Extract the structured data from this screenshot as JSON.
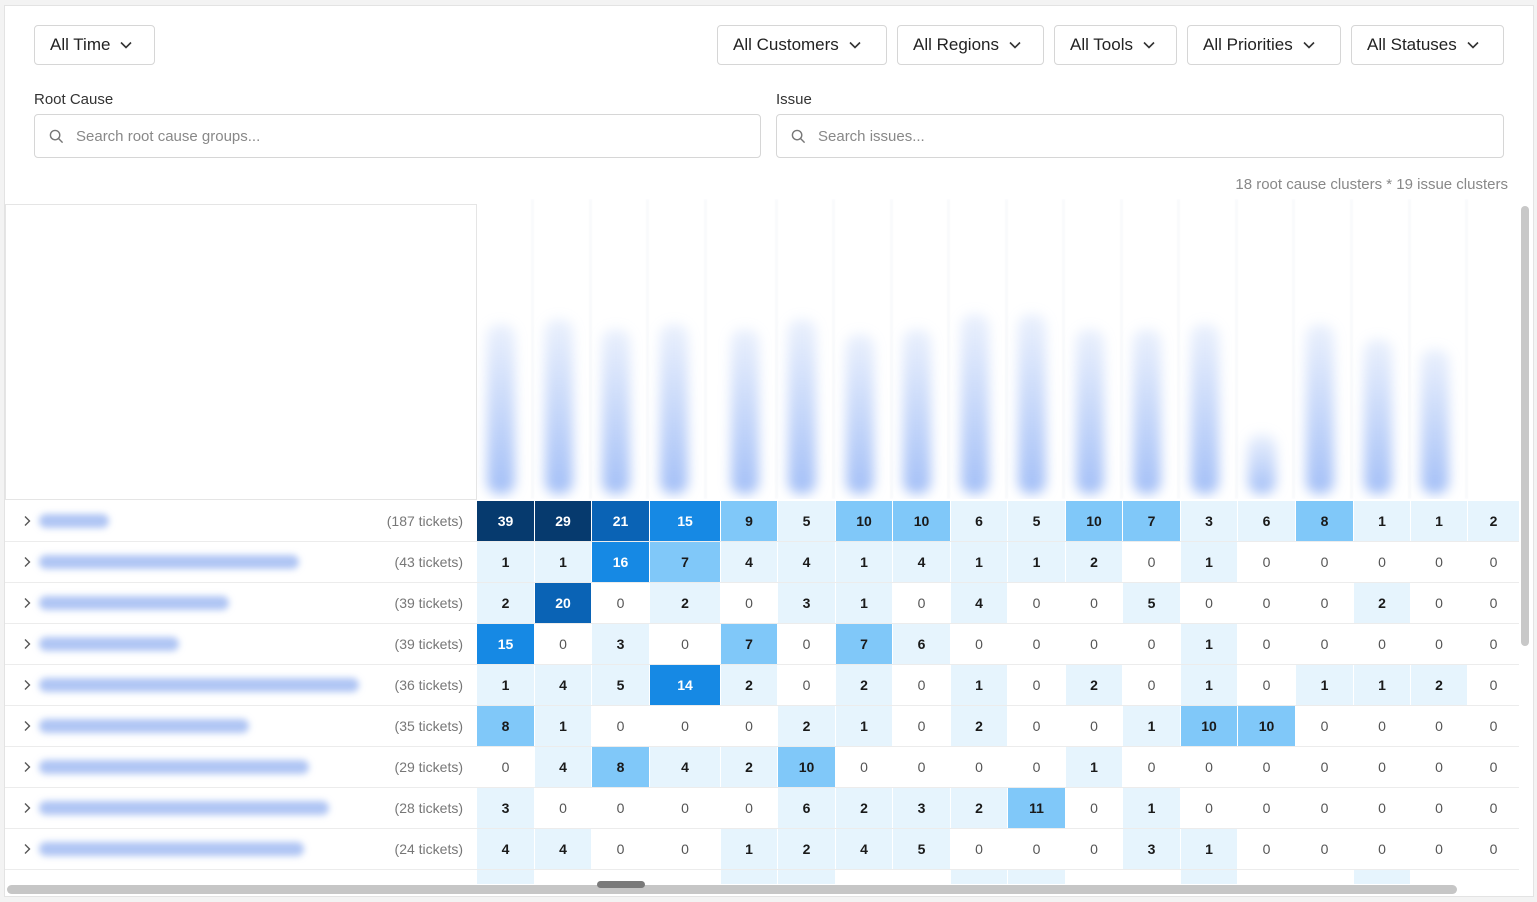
{
  "filters": {
    "time": "All Time",
    "customers": "All Customers",
    "regions": "All Regions",
    "tools": "All Tools",
    "priorities": "All Priorities",
    "statuses": "All Statuses"
  },
  "root_cause": {
    "label": "Root Cause",
    "placeholder": "Search root cause groups..."
  },
  "issue": {
    "label": "Issue",
    "placeholder": "Search issues..."
  },
  "summary": "18 root cause clusters * 19 issue clusters",
  "colors": {
    "level1": "#e6f4fd",
    "level2": "#80c8f9",
    "level3": "#1689e4",
    "level4": "#0a63b5",
    "level5": "#063a6e"
  },
  "rows": [
    {
      "tickets": "(187 tickets)",
      "values": [
        39,
        29,
        21,
        15,
        9,
        5,
        10,
        10,
        6,
        5,
        10,
        7,
        3,
        6,
        8,
        1,
        1,
        2
      ]
    },
    {
      "tickets": "(43 tickets)",
      "values": [
        1,
        1,
        16,
        7,
        4,
        4,
        1,
        4,
        1,
        1,
        2,
        0,
        1,
        0,
        0,
        0,
        0,
        0
      ]
    },
    {
      "tickets": "(39 tickets)",
      "values": [
        2,
        20,
        0,
        2,
        0,
        3,
        1,
        0,
        4,
        0,
        0,
        5,
        0,
        0,
        0,
        2,
        0,
        0
      ]
    },
    {
      "tickets": "(39 tickets)",
      "values": [
        15,
        0,
        3,
        0,
        7,
        0,
        7,
        6,
        0,
        0,
        0,
        0,
        1,
        0,
        0,
        0,
        0,
        0
      ]
    },
    {
      "tickets": "(36 tickets)",
      "values": [
        1,
        4,
        5,
        14,
        2,
        0,
        2,
        0,
        1,
        0,
        2,
        0,
        1,
        0,
        1,
        1,
        2,
        0
      ]
    },
    {
      "tickets": "(35 tickets)",
      "values": [
        8,
        1,
        0,
        0,
        0,
        2,
        1,
        0,
        2,
        0,
        0,
        1,
        10,
        10,
        0,
        0,
        0,
        0
      ]
    },
    {
      "tickets": "(29 tickets)",
      "values": [
        0,
        4,
        8,
        4,
        2,
        10,
        0,
        0,
        0,
        0,
        1,
        0,
        0,
        0,
        0,
        0,
        0,
        0
      ]
    },
    {
      "tickets": "(28 tickets)",
      "values": [
        3,
        0,
        0,
        0,
        0,
        6,
        2,
        3,
        2,
        11,
        0,
        1,
        0,
        0,
        0,
        0,
        0,
        0
      ]
    },
    {
      "tickets": "(24 tickets)",
      "values": [
        4,
        4,
        0,
        0,
        1,
        2,
        4,
        5,
        0,
        0,
        0,
        3,
        1,
        0,
        0,
        0,
        0,
        0
      ]
    }
  ]
}
